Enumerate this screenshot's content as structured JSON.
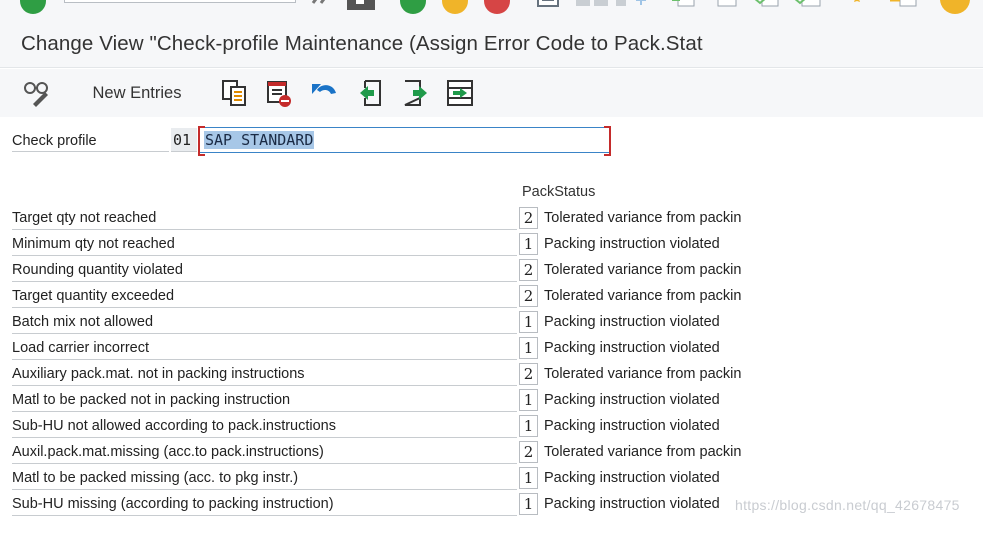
{
  "window": {
    "title": "Change View \"Check-profile Maintenance (Assign Error Code to Pack.Stat"
  },
  "system_toolbar": {
    "icons": [
      "confirm-icon",
      "back-double-icon",
      "save-icon",
      "back-icon",
      "exit-icon",
      "cancel-icon",
      "print-icon",
      "find-icon",
      "find-next-icon",
      "first-page-icon",
      "prev-page-icon",
      "next-page-icon",
      "last-page-icon",
      "favorites-icon",
      "shortcut-icon",
      "help-icon"
    ],
    "colors": {
      "green": "#2f9e44",
      "yellow": "#f0b429",
      "red": "#d64545"
    }
  },
  "app_toolbar": {
    "new_entries_label": "New Entries",
    "icons": [
      "display-change-icon",
      "copy-as-icon",
      "delete-icon",
      "undo-icon",
      "select-all-icon",
      "select-block-icon",
      "deselect-all-icon"
    ]
  },
  "header": {
    "check_profile_label": "Check profile",
    "check_profile_code": "01",
    "check_profile_desc": "SAP STANDARD"
  },
  "table": {
    "column_header": "PackStatus",
    "rows": [
      {
        "name": "Target qty not reached",
        "value": "2",
        "desc": "Tolerated variance from packin"
      },
      {
        "name": "Minimum qty not reached",
        "value": "1",
        "desc": "Packing instruction violated"
      },
      {
        "name": "Rounding quantity violated",
        "value": "2",
        "desc": "Tolerated variance from packin"
      },
      {
        "name": "Target quantity exceeded",
        "value": "2",
        "desc": "Tolerated variance from packin"
      },
      {
        "name": "Batch mix not allowed",
        "value": "1",
        "desc": "Packing instruction violated"
      },
      {
        "name": "Load carrier incorrect",
        "value": "1",
        "desc": "Packing instruction violated"
      },
      {
        "name": "Auxiliary pack.mat. not in packing instructions",
        "value": "2",
        "desc": "Tolerated variance from packin"
      },
      {
        "name": "Matl to be packed not in packing instruction",
        "value": "1",
        "desc": "Packing instruction violated"
      },
      {
        "name": "Sub-HU not allowed according to pack.instructions",
        "value": "1",
        "desc": "Packing instruction violated"
      },
      {
        "name": "Auxil.pack.mat.missing (acc.to pack.instructions)",
        "value": "2",
        "desc": "Tolerated variance from packin"
      },
      {
        "name": "Matl to be packed missing (acc. to pkg instr.)",
        "value": "1",
        "desc": "Packing instruction violated"
      },
      {
        "name": "Sub-HU missing (according to packing instruction)",
        "value": "1",
        "desc": "Packing instruction violated"
      }
    ]
  },
  "watermark": "https://blog.csdn.net/qq_42678475"
}
